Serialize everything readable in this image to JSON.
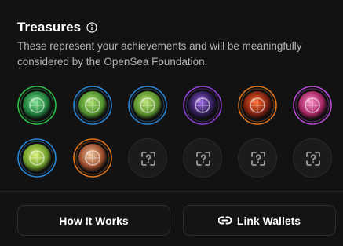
{
  "section": {
    "title": "Treasures",
    "description": "These represent your achievements and will be meaningfully considered by the OpenSea Foundation."
  },
  "badges": [
    {
      "name": "badge-green-dragon",
      "ring": "#2fbf4a",
      "glow": "#79e08a",
      "core": "#1e7b3a"
    },
    {
      "name": "badge-blue-anchor",
      "ring": "#2a86d4",
      "glow": "#a8e06a",
      "core": "#4f8f2e"
    },
    {
      "name": "badge-blue-helm",
      "ring": "#2a86d4",
      "glow": "#b6e46e",
      "core": "#5a8f2e"
    },
    {
      "name": "badge-purple-orb",
      "ring": "#8a3fd1",
      "glow": "#9a64e8",
      "core": "#2b1a4f"
    },
    {
      "name": "badge-orange-flame",
      "ring": "#e0741c",
      "glow": "#ff6a2a",
      "core": "#7a1f10"
    },
    {
      "name": "badge-pink-chest",
      "ring": "#b84ad0",
      "glow": "#ff8ec8",
      "core": "#a2235f"
    },
    {
      "name": "badge-blue-compass",
      "ring": "#2a86d4",
      "glow": "#d6f070",
      "core": "#6d9a2a"
    },
    {
      "name": "badge-orange-shell",
      "ring": "#e0741c",
      "glow": "#f1c79a",
      "core": "#9a4a2a"
    }
  ],
  "locked_count": 4,
  "buttons": {
    "how_it_works": "How It Works",
    "link_wallets": "Link Wallets"
  }
}
